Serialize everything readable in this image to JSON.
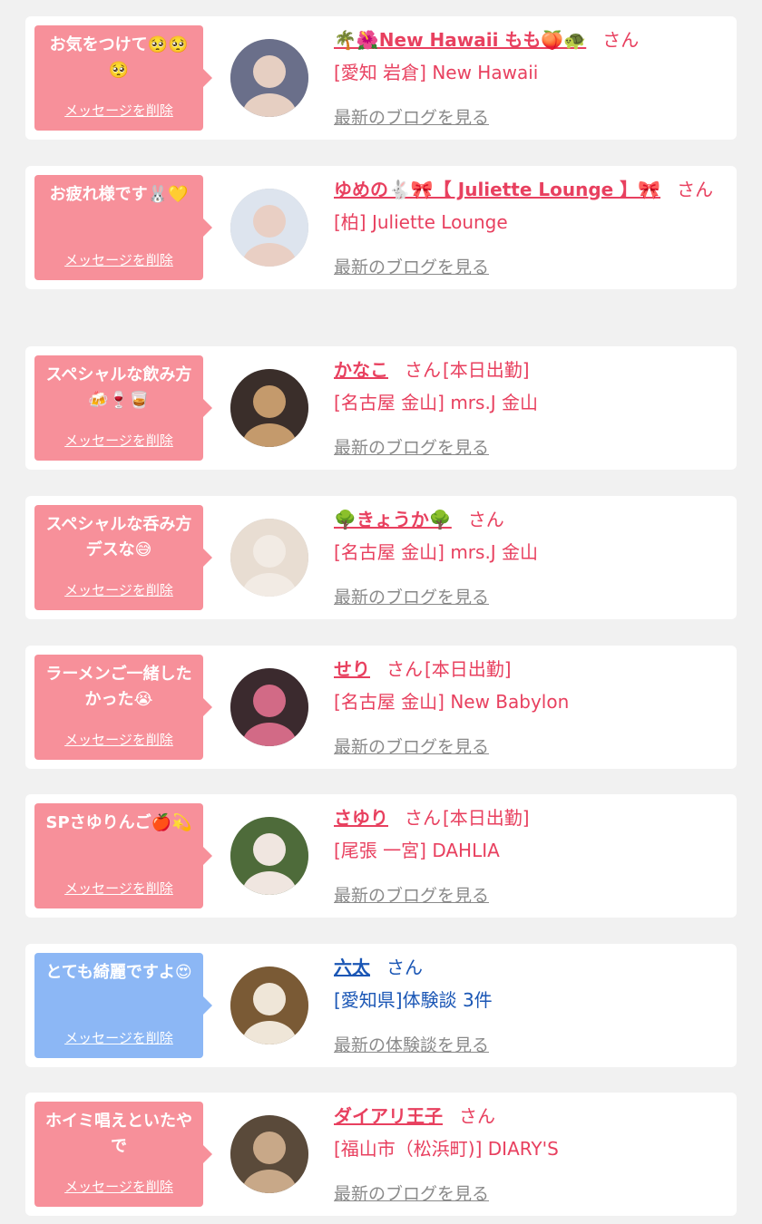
{
  "cards": [
    {
      "type": "pink",
      "message": "お気をつけて🥺🥺🥺",
      "delete_label": "メッセージを削除",
      "name": "🌴🌺New Hawaii もも🍑🐢",
      "san": "さん",
      "tag": "",
      "shop": "[愛知 岩倉] New Hawaii",
      "link": "最新のブログを見る",
      "avatar": {
        "bg": "#6a6f8a",
        "fg": "#e6cfc2"
      }
    },
    {
      "type": "pink",
      "message": "お疲れ様です🐰💛",
      "delete_label": "メッセージを削除",
      "name": "ゆめの🐇🎀【 Juliette Lounge 】🎀",
      "san": "さん",
      "tag": "",
      "shop": "[柏] Juliette Lounge",
      "link": "最新のブログを見る",
      "avatar": {
        "bg": "#dde4ee",
        "fg": "#e9cfc4"
      }
    },
    {
      "type": "pink",
      "message": "スペシャルな飲み方🍻🍷🥃",
      "delete_label": "メッセージを削除",
      "name": "かなこ",
      "san": "さん",
      "tag": "[本日出勤]",
      "shop": "[名古屋 金山] mrs.J 金山",
      "link": "最新のブログを見る",
      "avatar": {
        "bg": "#3a2e2a",
        "fg": "#c49a6c"
      }
    },
    {
      "type": "pink",
      "message": "スペシャルな呑み方デスな😅",
      "delete_label": "メッセージを削除",
      "name": "🌳きょうか🌳",
      "san": "さん",
      "tag": "",
      "shop": "[名古屋 金山] mrs.J 金山",
      "link": "最新のブログを見る",
      "avatar": {
        "bg": "#e8ddd2",
        "fg": "#f2ebe4"
      }
    },
    {
      "type": "pink",
      "message": "ラーメンご一緒したかった😭",
      "delete_label": "メッセージを削除",
      "name": "せり",
      "san": "さん",
      "tag": "[本日出勤]",
      "shop": "[名古屋 金山] New Babylon",
      "link": "最新のブログを見る",
      "avatar": {
        "bg": "#3b2a2e",
        "fg": "#d26a86"
      }
    },
    {
      "type": "pink",
      "message": "SPさゆりんご🍎💫",
      "delete_label": "メッセージを削除",
      "name": "さゆり",
      "san": "さん",
      "tag": "[本日出勤]",
      "shop": "[尾張 一宮] DAHLIA",
      "link": "最新のブログを見る",
      "avatar": {
        "bg": "#4e6b3a",
        "fg": "#f0e6e0"
      }
    },
    {
      "type": "blue",
      "message": "とても綺麗ですよ😍",
      "delete_label": "メッセージを削除",
      "name": "六太",
      "san": "さん",
      "tag": "",
      "shop": "[愛知県]体験談 3件",
      "link": "最新の体験談を見る",
      "avatar": {
        "bg": "#7a5a35",
        "fg": "#efe6d8"
      }
    },
    {
      "type": "pink",
      "message": "ホイミ唱えといたやで",
      "delete_label": "メッセージを削除",
      "name": "ダイアリ王子",
      "san": "さん",
      "tag": "",
      "shop": "[福山市（松浜町)] DIARY'S",
      "link": "最新のブログを見る",
      "avatar": {
        "bg": "#5a4a3a",
        "fg": "#c8a888"
      }
    }
  ]
}
